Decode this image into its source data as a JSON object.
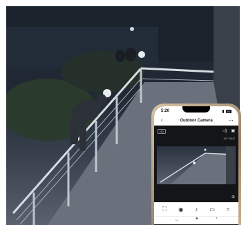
{
  "app": {
    "status": {
      "time": "5:20",
      "battery": "60"
    },
    "navbar": {
      "back_icon": "back-arrow-icon",
      "title": "Outdoor Camera",
      "more_icon": "more-icon"
    },
    "viewer": {
      "quality_badge": "HD",
      "bitrate": "187 KB/S",
      "icons": [
        "speaker-icon",
        "fullscreen-icon"
      ],
      "zoom_icon": "zoom-in-icon"
    },
    "toolbar": [
      {
        "name": "scan-icon",
        "glyph": "⛶"
      },
      {
        "name": "camera-snapshot-icon",
        "glyph": "◉"
      },
      {
        "name": "microphone-icon",
        "glyph": "♪"
      },
      {
        "name": "record-video-icon",
        "glyph": "▭"
      },
      {
        "name": "more-controls-icon",
        "glyph": "≈"
      }
    ]
  },
  "colors": {
    "night_scene": "#1d2530",
    "phone_frame": "#c8b08e",
    "screen": "#0e0f12"
  }
}
